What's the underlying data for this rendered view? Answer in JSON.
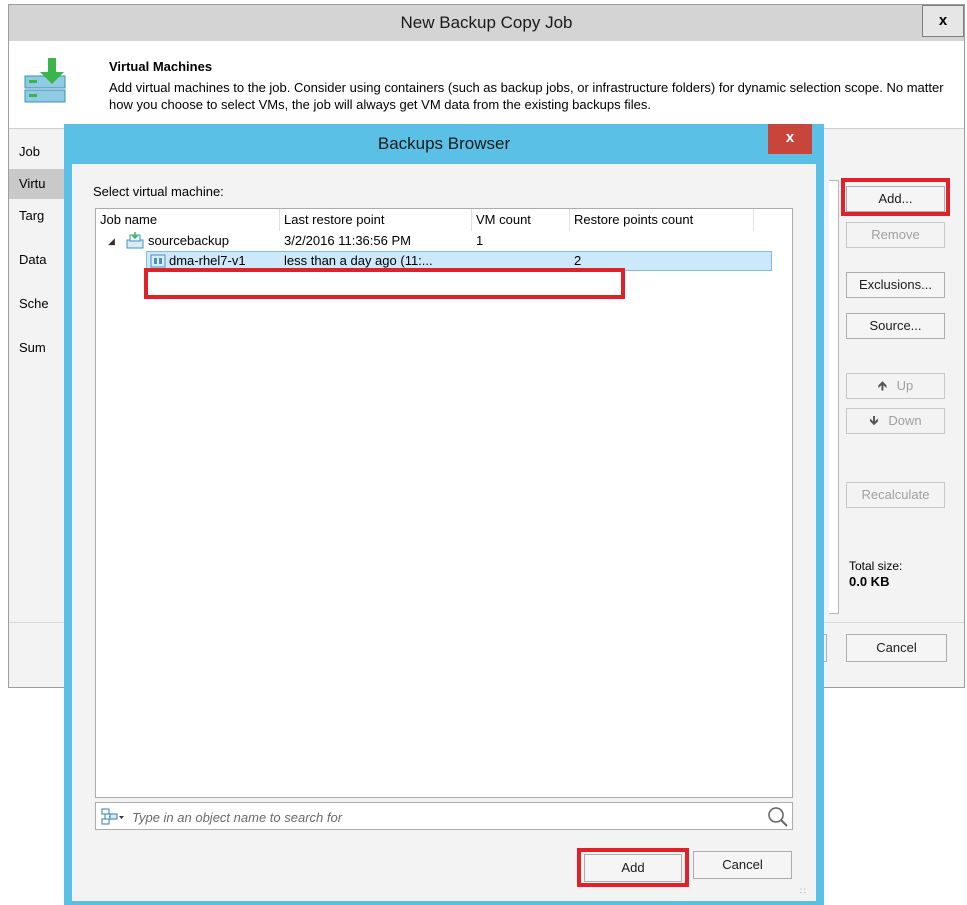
{
  "outer_window": {
    "title": "New Backup Copy Job",
    "close_label": "x",
    "header_title": "Virtual Machines",
    "header_description": "Add virtual machines to the job. Consider using containers (such as backup jobs, or infrastructure folders) for dynamic selection scope. No matter how you choose to select VMs, the job will always get VM data from the existing backups files.",
    "nav": [
      {
        "label": "Job"
      },
      {
        "label": "Virtu"
      },
      {
        "label": "Targ"
      },
      {
        "label": "Data"
      },
      {
        "label": "Sche"
      },
      {
        "label": "Sum"
      }
    ],
    "buttons": {
      "add": "Add...",
      "remove": "Remove",
      "exclusions": "Exclusions...",
      "source": "Source...",
      "up": "Up",
      "down": "Down",
      "recalculate": "Recalculate",
      "cancel": "Cancel"
    },
    "total_size_label": "Total size:",
    "total_size_value": "0.0 KB"
  },
  "browser": {
    "title": "Backups Browser",
    "close_label": "x",
    "select_label": "Select virtual machine:",
    "columns": [
      "Job name",
      "Last restore point",
      "VM count",
      "Restore points count"
    ],
    "rows": [
      {
        "name": "sourcebackup",
        "last_restore_point": "3/2/2016 11:36:56 PM",
        "vm_count": "1",
        "restore_points_count": ""
      },
      {
        "name": "dma-rhel7-v1",
        "last_restore_point": "less than a day ago (11:...",
        "vm_count": "",
        "restore_points_count": "2"
      }
    ],
    "search_placeholder": "Type in an object name to search for",
    "add_label": "Add",
    "cancel_label": "Cancel"
  },
  "colors": {
    "dialog_frame": "#5bc0e6",
    "highlight_red": "#e1202a",
    "selection": "#cde8fb",
    "accent_green": "#39b54a"
  }
}
